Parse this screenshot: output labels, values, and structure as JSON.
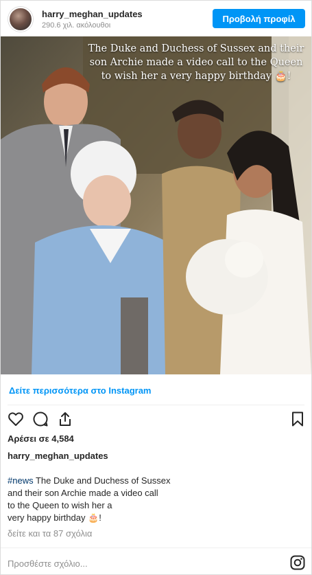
{
  "header": {
    "username": "harry_meghan_updates",
    "followers": "290.6 χιλ. ακόλουθοι",
    "profile_button": "Προβολή προφίλ"
  },
  "photo": {
    "overlay_text": "The Duke and Duchess of Sussex and their son Archie made a video call to the Queen to wish her a very happy birthday 🎂!"
  },
  "see_more_link": "Δείτε περισσότερα στο Instagram",
  "actions": {
    "like_icon": "heart-icon",
    "comment_icon": "comment-icon",
    "share_icon": "share-icon",
    "save_icon": "bookmark-icon"
  },
  "likes": "Αρέσει σε 4,584",
  "post": {
    "username": "harry_meghan_updates",
    "hashtag": "#news",
    "caption_lines": [
      " The Duke and Duchess of Sussex",
      "and their son Archie made a video call",
      "to the Queen to wish her a",
      "very happy birthday 🎂!"
    ]
  },
  "comments_link": "δείτε και τα 87 σχόλια",
  "comment_placeholder": "Προσθέστε σχόλιο...",
  "colors": {
    "accent": "#0095f6",
    "hashtag": "#00376b",
    "muted": "#8e8e8e"
  }
}
